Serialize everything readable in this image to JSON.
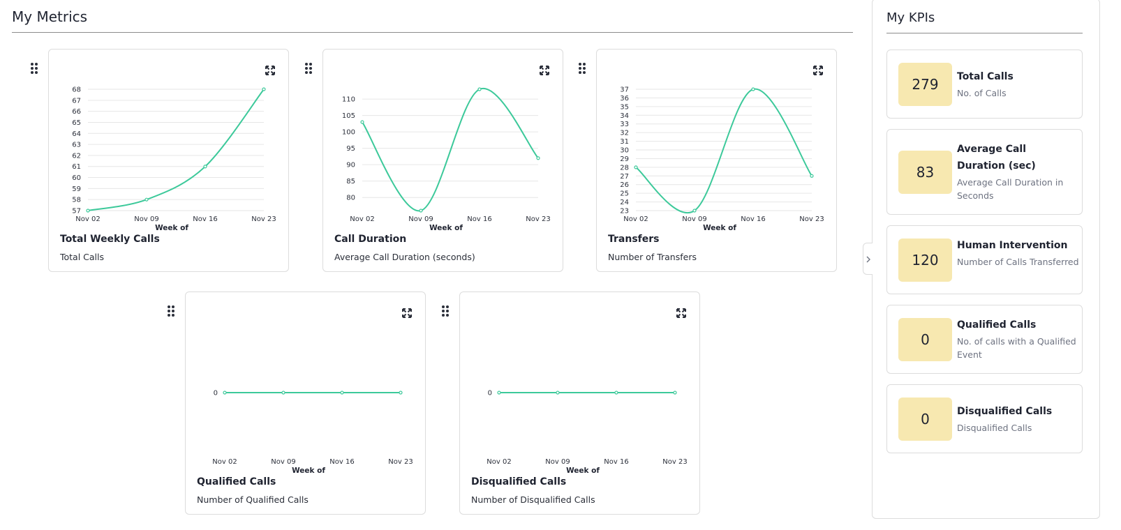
{
  "metrics": {
    "title": "My Metrics",
    "charts": [
      {
        "title": "Total Weekly Calls",
        "subtitle": "Total Calls"
      },
      {
        "title": "Call Duration",
        "subtitle": "Average Call Duration (seconds)"
      },
      {
        "title": "Transfers",
        "subtitle": "Number of Transfers"
      },
      {
        "title": "Qualified Calls",
        "subtitle": "Number of Qualified Calls"
      },
      {
        "title": "Disqualified Calls",
        "subtitle": "Number of Disqualified Calls"
      }
    ]
  },
  "kpis": {
    "title": "My KPIs",
    "items": [
      {
        "value": "279",
        "name": "Total Calls",
        "desc": "No. of Calls"
      },
      {
        "value": "83",
        "name": "Average Call Duration (sec)",
        "desc": "Average Call Duration in Seconds"
      },
      {
        "value": "120",
        "name": "Human Intervention",
        "desc": "Number of Calls Transferred"
      },
      {
        "value": "0",
        "name": "Qualified Calls",
        "desc": "No. of calls with a Qualified Event"
      },
      {
        "value": "0",
        "name": "Disqualified Calls",
        "desc": "Disqualified Calls"
      }
    ]
  },
  "colors": {
    "line": "#3cc99a",
    "kpi_badge": "#f7e8b0",
    "grid": "#e6e6e6"
  },
  "icons": {
    "drag": "drag-handle-icon",
    "expand": "expand-icon",
    "collapse": "chevron-right-icon"
  },
  "chart_data": [
    {
      "type": "line",
      "x": [
        "Nov 02",
        "Nov 09",
        "Nov 16",
        "Nov 23"
      ],
      "xlabel": "Week of",
      "ylabel": "",
      "series": [
        {
          "values": [
            57,
            58,
            61,
            68
          ]
        }
      ],
      "yticks": [
        57,
        58,
        59,
        60,
        61,
        62,
        63,
        64,
        65,
        66,
        67,
        68
      ],
      "ylim": [
        57,
        68
      ],
      "grid": true
    },
    {
      "type": "line",
      "x": [
        "Nov 02",
        "Nov 09",
        "Nov 16",
        "Nov 23"
      ],
      "xlabel": "Week of",
      "ylabel": "",
      "series": [
        {
          "values": [
            103,
            76,
            113,
            92
          ]
        }
      ],
      "yticks": [
        80,
        85,
        90,
        95,
        100,
        105,
        110
      ],
      "ylim": [
        76,
        113
      ],
      "grid": true
    },
    {
      "type": "line",
      "x": [
        "Nov 02",
        "Nov 09",
        "Nov 16",
        "Nov 23"
      ],
      "xlabel": "Week of",
      "ylabel": "",
      "series": [
        {
          "values": [
            28,
            23,
            37,
            27
          ]
        }
      ],
      "yticks": [
        23,
        24,
        25,
        26,
        27,
        28,
        29,
        30,
        31,
        32,
        33,
        34,
        35,
        36,
        37
      ],
      "ylim": [
        23,
        37
      ],
      "grid": true
    },
    {
      "type": "line",
      "x": [
        "Nov 02",
        "Nov 09",
        "Nov 16",
        "Nov 23"
      ],
      "xlabel": "Week of",
      "ylabel": "",
      "series": [
        {
          "values": [
            0,
            0,
            0,
            0
          ]
        }
      ],
      "yticks": [
        0
      ],
      "ylim": [
        -1,
        1
      ],
      "grid": false
    },
    {
      "type": "line",
      "x": [
        "Nov 02",
        "Nov 09",
        "Nov 16",
        "Nov 23"
      ],
      "xlabel": "Week of",
      "ylabel": "",
      "series": [
        {
          "values": [
            0,
            0,
            0,
            0
          ]
        }
      ],
      "yticks": [
        0
      ],
      "ylim": [
        -1,
        1
      ],
      "grid": false
    }
  ]
}
